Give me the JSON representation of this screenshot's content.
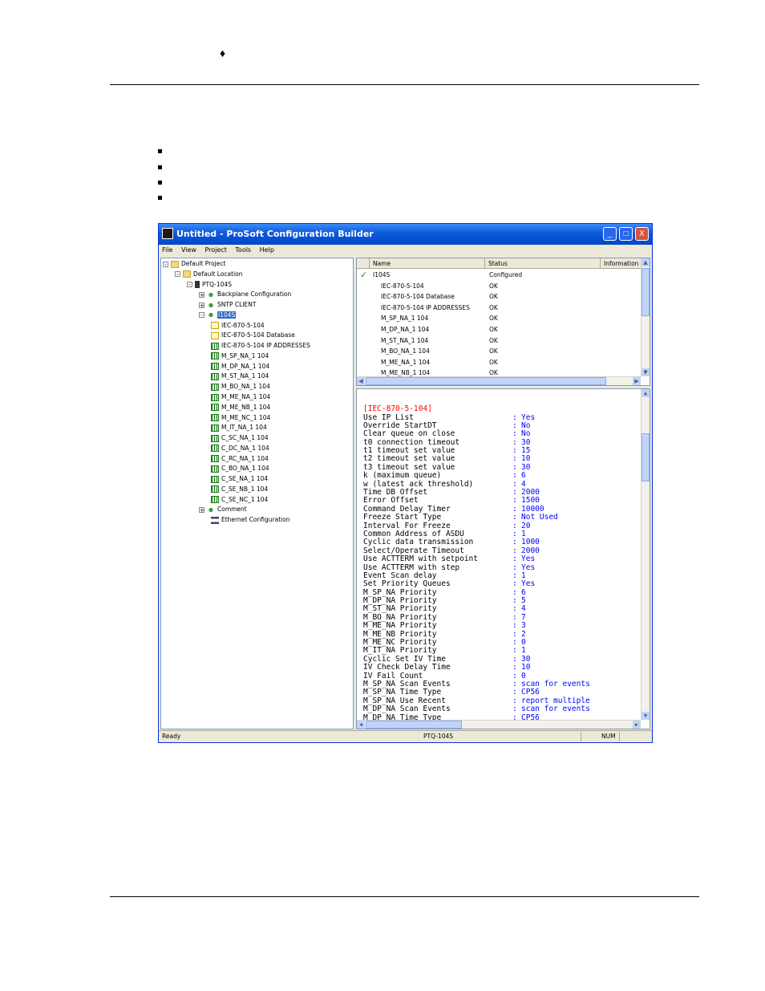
{
  "page": {
    "marker": "♦"
  },
  "window": {
    "title": "Untitled - ProSoft Configuration Builder",
    "buttons": {
      "min": "_",
      "max": "□",
      "close": "X"
    },
    "menu": [
      "File",
      "View",
      "Project",
      "Tools",
      "Help"
    ]
  },
  "tree": {
    "items": [
      {
        "label": "Default Project",
        "expander": "-",
        "icon": "folder-icon"
      },
      {
        "label": "Default Location",
        "expander": "-",
        "icon": "folder-icon"
      },
      {
        "label": "PTQ-104S",
        "expander": "-",
        "icon": "device-icon"
      },
      {
        "label": "Backplane Configuration",
        "expander": "+",
        "icon": "network-icon"
      },
      {
        "label": "SNTP CLIENT",
        "expander": "+",
        "icon": "network-icon"
      },
      {
        "label": "I104S",
        "expander": "-",
        "icon": "network-icon"
      },
      {
        "label": "IEC-870-5-104",
        "expander": "",
        "icon": "document-icon"
      },
      {
        "label": "IEC-870-5-104 Database",
        "expander": "",
        "icon": "document-icon"
      },
      {
        "label": "IEC-870-5-104 IP ADDRESSES",
        "expander": "",
        "icon": "grid-icon"
      },
      {
        "label": "M_SP_NA_1 104",
        "expander": "",
        "icon": "grid-icon"
      },
      {
        "label": "M_DP_NA_1 104",
        "expander": "",
        "icon": "grid-icon"
      },
      {
        "label": "M_ST_NA_1 104",
        "expander": "",
        "icon": "grid-icon"
      },
      {
        "label": "M_BO_NA_1 104",
        "expander": "",
        "icon": "grid-icon"
      },
      {
        "label": "M_ME_NA_1 104",
        "expander": "",
        "icon": "grid-icon"
      },
      {
        "label": "M_ME_NB_1 104",
        "expander": "",
        "icon": "grid-icon"
      },
      {
        "label": "M_ME_NC_1 104",
        "expander": "",
        "icon": "grid-icon"
      },
      {
        "label": "M_IT_NA_1 104",
        "expander": "",
        "icon": "grid-icon"
      },
      {
        "label": "C_SC_NA_1 104",
        "expander": "",
        "icon": "grid-icon"
      },
      {
        "label": "C_DC_NA_1 104",
        "expander": "",
        "icon": "grid-icon"
      },
      {
        "label": "C_RC_NA_1 104",
        "expander": "",
        "icon": "grid-icon"
      },
      {
        "label": "C_BO_NA_1 104",
        "expander": "",
        "icon": "grid-icon"
      },
      {
        "label": "C_SE_NA_1 104",
        "expander": "",
        "icon": "grid-icon"
      },
      {
        "label": "C_SE_NB_1 104",
        "expander": "",
        "icon": "grid-icon"
      },
      {
        "label": "C_SE_NC_1 104",
        "expander": "",
        "icon": "grid-icon"
      },
      {
        "label": "Comment",
        "expander": "+",
        "icon": "network-icon"
      },
      {
        "label": "Ethernet Configuration",
        "expander": "",
        "icon": "ethernet-icon"
      }
    ]
  },
  "list": {
    "columns": [
      "Name",
      "Status",
      "Information"
    ],
    "check": "✓",
    "rows": [
      {
        "name": "I104S",
        "status": "Configured"
      },
      {
        "name": "IEC-870-5-104",
        "status": "OK"
      },
      {
        "name": "IEC-870-5-104 Database",
        "status": "OK"
      },
      {
        "name": "IEC-870-5-104 IP ADDRESSES",
        "status": "OK"
      },
      {
        "name": "M_SP_NA_1 104",
        "status": "OK"
      },
      {
        "name": "M_DP_NA_1 104",
        "status": "OK"
      },
      {
        "name": "M_ST_NA_1 104",
        "status": "OK"
      },
      {
        "name": "M_BO_NA_1 104",
        "status": "OK"
      },
      {
        "name": "M_ME_NA_1 104",
        "status": "OK"
      },
      {
        "name": "M_ME_NB_1 104",
        "status": "OK"
      }
    ]
  },
  "detail": {
    "header": "[IEC-870-5-104]",
    "separator": ":",
    "lines": [
      {
        "key": "Use IP List",
        "value": "Yes"
      },
      {
        "key": "Override StartDT",
        "value": "No"
      },
      {
        "key": "Clear queue on close",
        "value": "No"
      },
      {
        "key": "t0 connection timeout",
        "value": "30"
      },
      {
        "key": "t1 timeout set value",
        "value": "15"
      },
      {
        "key": "t2 timeout set value",
        "value": "10"
      },
      {
        "key": "t3 timeout set value",
        "value": "30"
      },
      {
        "key": "k (maximum queue)",
        "value": "6"
      },
      {
        "key": "w (latest ack threshold)",
        "value": "4"
      },
      {
        "key": "Time DB Offset",
        "value": "2000"
      },
      {
        "key": "Error Offset",
        "value": "1500"
      },
      {
        "key": "Command Delay Timer",
        "value": "10000"
      },
      {
        "key": "Freeze Start Type",
        "value": "Not Used"
      },
      {
        "key": "Interval For Freeze",
        "value": "20"
      },
      {
        "key": "Common Address of ASDU",
        "value": "1"
      },
      {
        "key": "Cyclic data transmission",
        "value": "1000"
      },
      {
        "key": "Select/Operate Timeout",
        "value": "2000"
      },
      {
        "key": "Use ACTTERM with setpoint",
        "value": "Yes"
      },
      {
        "key": "Use ACTTERM with step",
        "value": "Yes"
      },
      {
        "key": "Event Scan delay",
        "value": "1"
      },
      {
        "key": "Set Priority Queues",
        "value": "Yes"
      },
      {
        "key": "M_SP_NA Priority",
        "value": "6"
      },
      {
        "key": "M_DP_NA Priority",
        "value": "5"
      },
      {
        "key": "M_ST_NA Priority",
        "value": "4"
      },
      {
        "key": "M_BO_NA Priority",
        "value": "7"
      },
      {
        "key": "M_ME_NA Priority",
        "value": "3"
      },
      {
        "key": "M_ME_NB Priority",
        "value": "2"
      },
      {
        "key": "M_ME_NC Priority",
        "value": "0"
      },
      {
        "key": "M_IT_NA Priority",
        "value": "1"
      },
      {
        "key": "Cyclic Set IV Time",
        "value": "30"
      },
      {
        "key": "IV Check Delay Time",
        "value": "10"
      },
      {
        "key": "IV Fail Count",
        "value": "0"
      },
      {
        "key": "M_SP_NA Scan Events",
        "value": "scan for events"
      },
      {
        "key": "M_SP_NA Time Type",
        "value": "CP56"
      },
      {
        "key": "M_SP_NA Use Recent",
        "value": "report multiple"
      },
      {
        "key": "M_DP_NA Scan Events",
        "value": "scan for events"
      },
      {
        "key": "M_DP_NA Time Type",
        "value": "CP56"
      }
    ]
  },
  "statusbar": {
    "left": "Ready",
    "center": "PTQ-104S",
    "num": "NUM"
  }
}
